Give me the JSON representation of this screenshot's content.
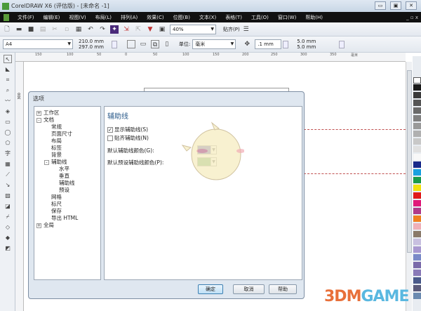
{
  "window": {
    "title": "CorelDRAW X6 (评估版) - [未命名 -1]",
    "min": "▭",
    "max": "▣",
    "close": "✕"
  },
  "menu": {
    "items": [
      "文件(F)",
      "编辑(E)",
      "视图(V)",
      "布局(L)",
      "排列(A)",
      "效果(C)",
      "位图(B)",
      "文本(X)",
      "表格(T)",
      "工具(O)",
      "窗口(W)",
      "帮助(H)"
    ],
    "controls": "_ ▫ x"
  },
  "toolbar": {
    "zoom": "40%",
    "snap": "贴齐(P)"
  },
  "propbar": {
    "page_size": "A4",
    "width": "210.0 mm",
    "height": "297.0 mm",
    "unit_label": "单位:",
    "unit": "毫米",
    "nudge": ".1 mm",
    "dup_x": "5.0 mm",
    "dup_y": "5.0 mm"
  },
  "ruler": {
    "ticks": [
      "150",
      "100",
      "50",
      "0",
      "50",
      "100",
      "150",
      "200",
      "250",
      "300",
      "350"
    ],
    "unit": "毫米",
    "v_tick": "300"
  },
  "dialog": {
    "title": "选项",
    "tree": [
      {
        "label": "工作区",
        "sign": "+"
      },
      {
        "label": "文档",
        "sign": "-"
      },
      {
        "label": "常规"
      },
      {
        "label": "页面尺寸"
      },
      {
        "label": "布局"
      },
      {
        "label": "标签"
      },
      {
        "label": "背景"
      },
      {
        "label": "辅助线",
        "sign": "-"
      },
      {
        "label": "水平"
      },
      {
        "label": "垂直"
      },
      {
        "label": "辅助线"
      },
      {
        "label": "预设"
      },
      {
        "label": "网格"
      },
      {
        "label": "标尺"
      },
      {
        "label": "保存"
      },
      {
        "label": "导出 HTML"
      },
      {
        "label": "全局",
        "sign": "+"
      }
    ],
    "panel_title": "辅助线",
    "show_guides": {
      "label": "显示辅助线(S)",
      "checked": true
    },
    "snap_guides": {
      "label": "贴齐辅助线(N)",
      "checked": false
    },
    "default_color_label": "默认辅助线颜色(G):",
    "default_color": "#1a1aa8",
    "preset_color_label": "默认预设辅助线颜色(P):",
    "preset_color": "#2e8a2e",
    "ok": "确定",
    "cancel": "取消",
    "help": "帮助"
  },
  "watermark": "3DMGAME",
  "palette": [
    "#1a1a1a",
    "#3a3a3a",
    "#555",
    "#6a6a6a",
    "#808080",
    "#999",
    "#b0b0b0",
    "#c8c8c8",
    "#e0e0e0",
    "#f8f8f8",
    "#1a2a8a",
    "#1aa0e0",
    "#1a9a4a",
    "#f0e010",
    "#e01a1a",
    "#e01a7a",
    "#b03a8a",
    "#f08020",
    "#f0b0b8",
    "#8a7a6a",
    "#c8c0e0",
    "#a898d0",
    "#7a8ac8",
    "#7a6aaa",
    "#8a7ab8",
    "#4a5a8a",
    "#5a5a7a",
    "#6a8ab0"
  ]
}
